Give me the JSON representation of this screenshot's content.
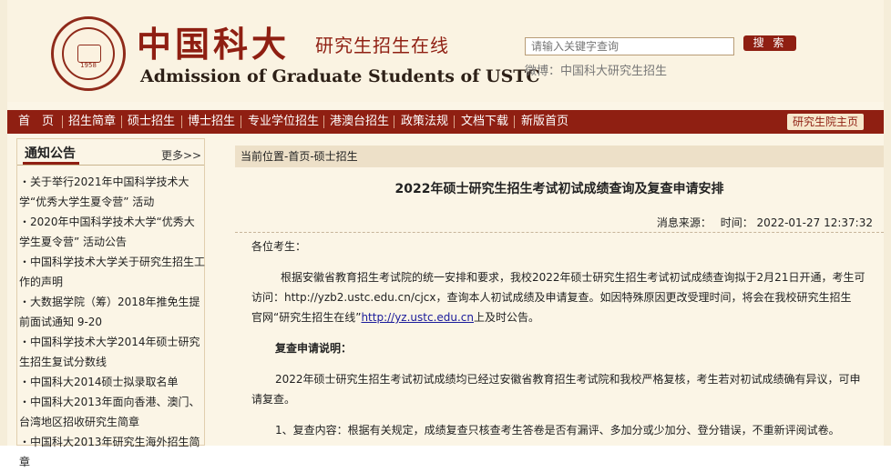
{
  "header": {
    "seal": {
      "year": "1958"
    },
    "title_cn": "中国科大",
    "title_sub": "研究生招生在线",
    "title_en": "Admission of Graduate Students of USTC",
    "search_placeholder": "请输入关键字查询",
    "search_button": "搜 索",
    "weibo": "微博：中国科大研究生招生"
  },
  "nav": {
    "items": [
      "首　页",
      "招生简章",
      "硕士招生",
      "博士招生",
      "专业学位招生",
      "港澳台招生",
      "政策法规",
      "文档下载",
      "新版首页"
    ],
    "home_button": "研究生院主页"
  },
  "sidebar": {
    "title": "通知公告",
    "more": "更多>>",
    "items": [
      "・关于举行2021年中国科学技术大学“优秀大学生夏令营” 活动",
      "・2020年中国科学技术大学“优秀大学生夏令营” 活动公告",
      "・中国科学技术大学关于研究生招生工作的声明",
      "・大数据学院（筹）2018年推免生提前面试通知 9-20",
      "・中国科学技术大学2014年硕士研究生招生复试分数线",
      "・中国科大2014硕士拟录取名单",
      "・中国科大2013年面向香港、澳门、台湾地区招收研究生简章",
      "・中国科大2013年研究生海外招生简章"
    ]
  },
  "article": {
    "breadcrumb": "当前位置-首页-硕士招生",
    "title": "2022年硕士研究生招生考试初试成绩查询及复查申请安排",
    "source_label": "消息来源：",
    "time_label": "时间：",
    "time_value": "2022-01-27 12:37:32",
    "greeting": "各位考生：",
    "para1_line1": "根据安徽省教育招生考试院的统一安排和要求，我校2022年硕士研究生招生考试初试成绩查询拟于2月21日开通，考生可",
    "para1_line2": "访问：http://yzb2.ustc.edu.cn/cjcx，查询本人初试成绩及申请复查。如因特殊原因更改受理时间，将会在我校研究生招生",
    "para1_line3_a": "官网“研究生招生在线”",
    "para1_link": "http://yz.ustc.edu.cn",
    "para1_line3_b": "上及时公告。",
    "section_title": "复查申请说明：",
    "para2_line1": "2022年硕士研究生招生考试初试成绩均已经过安徽省教育招生考试院和我校严格复核，考生若对初试成绩确有异议，可申",
    "para2_line2": "请复查。",
    "para3": "1、复查内容：根据有关规定，成绩复查只核查考生答卷是否有漏评、多加分或少加分、登分错误，不重新评阅试卷。"
  },
  "colors": {
    "accent": "#8f1f12",
    "background": "#fbf5e6",
    "breadcrumb_bg": "#ede0c8"
  }
}
